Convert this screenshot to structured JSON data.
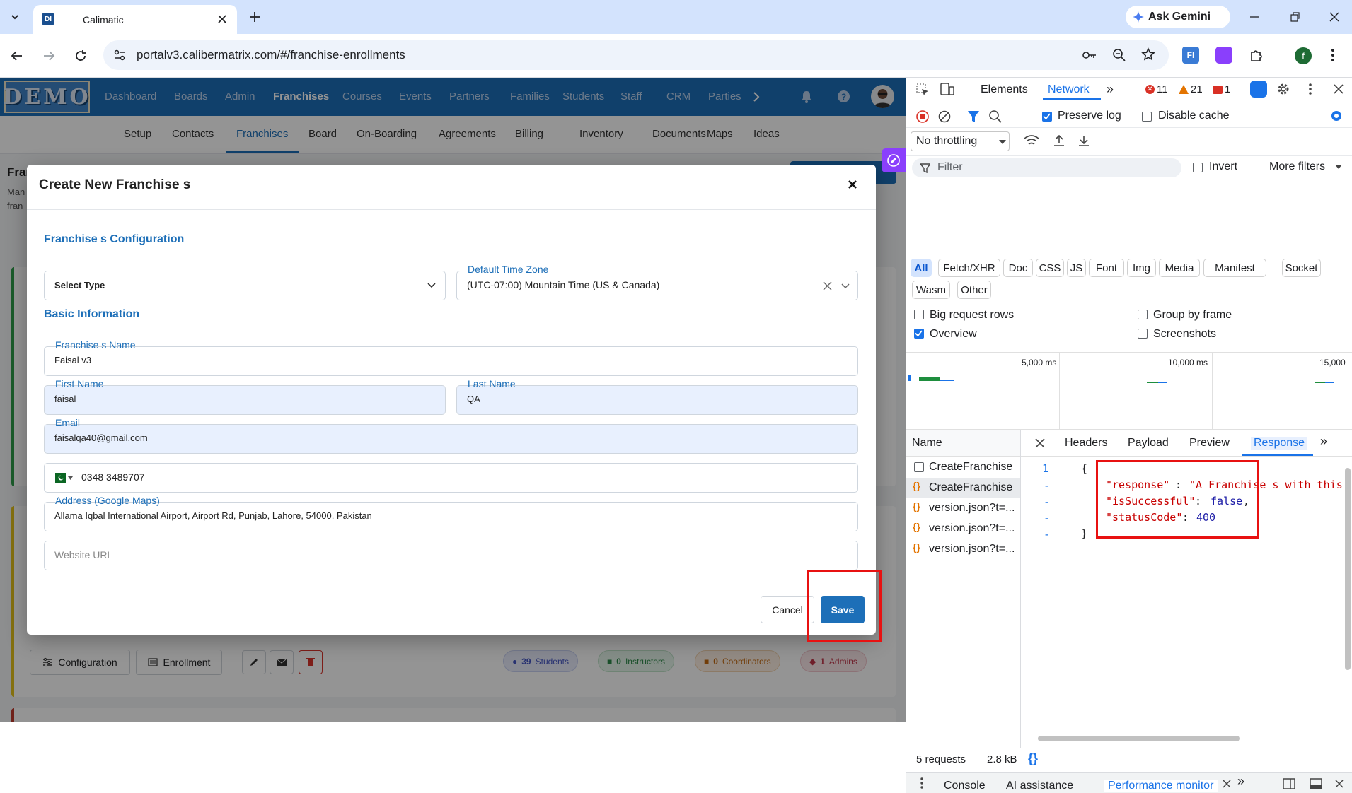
{
  "browser": {
    "tab_title": "Calimatic",
    "url": "portalv3.calibermatrix.com/#/franchise-enrollments",
    "ask_gemini": "Ask Gemini",
    "profile_initial": "f"
  },
  "app": {
    "logo": "DEMO",
    "nav": [
      "Dashboard",
      "Boards",
      "Admin",
      "Franchises",
      "Courses",
      "Events",
      "Partners",
      "Families",
      "Students",
      "Staff",
      "CRM",
      "Parties"
    ],
    "nav_active": "Franchises",
    "subnav": [
      "Setup",
      "Contacts",
      "Franchises",
      "Board",
      "On-Boarding",
      "Agreements",
      "Billing",
      "Inventory",
      "Documents",
      "Maps",
      "Ideas"
    ],
    "subnav_active": "Franchises",
    "bg_title_fragment": "Fran",
    "bg_desc_1": "Man",
    "bg_desc_2": "fran",
    "bottom_toolbar": {
      "configuration": "Configuration",
      "enrollment": "Enrollment",
      "students_count": "39",
      "students_label": "Students",
      "instructors_count": "0",
      "instructors_label": "Instructors",
      "coordinators_count": "0",
      "coordinators_label": "Coordinators",
      "admins_count": "1",
      "admins_label": "Admins"
    }
  },
  "modal": {
    "title": "Create New Franchise s",
    "section_config": "Franchise s Configuration",
    "select_type": "Select Type",
    "timezone_label": "Default Time Zone",
    "timezone_value": "(UTC-07:00) Mountain Time (US & Canada)",
    "section_basic": "Basic Information",
    "franchise_name_label": "Franchise s Name",
    "franchise_name_value": "Faisal v3",
    "first_name_label": "First Name",
    "first_name_value": "faisal",
    "last_name_label": "Last Name",
    "last_name_value": "QA",
    "email_label": "Email",
    "email_value": "faisalqa40@gmail.com",
    "phone_value": "0348 3489707",
    "address_label": "Address (Google Maps)",
    "address_value": "Allama Iqbal International Airport, Airport Rd, Punjab, Lahore, 54000, Pakistan",
    "website_placeholder": "Website URL",
    "cancel": "Cancel",
    "save": "Save"
  },
  "devtools": {
    "tabs": [
      "Elements",
      "Network"
    ],
    "active_tab": "Network",
    "errors": "11",
    "warnings": "21",
    "issues": "1",
    "preserve_log": "Preserve log",
    "disable_cache": "Disable cache",
    "throttling": "No throttling",
    "filter_placeholder": "Filter",
    "invert": "Invert",
    "more_filters": "More filters",
    "filter_chips": [
      "All",
      "Fetch/XHR",
      "Doc",
      "CSS",
      "JS",
      "Font",
      "Img",
      "Media",
      "Manifest",
      "Socket",
      "Wasm",
      "Other"
    ],
    "big_request_rows": "Big request rows",
    "group_by_frame": "Group by frame",
    "overview": "Overview",
    "screenshots": "Screenshots",
    "timeline_ticks": [
      "5,000 ms",
      "10,000 ms",
      "15,000"
    ],
    "name_header": "Name",
    "detail_tabs": [
      "Headers",
      "Payload",
      "Preview",
      "Response"
    ],
    "detail_active": "Response",
    "requests": [
      "CreateFranchise",
      "CreateFranchise",
      "version.json?t=...",
      "version.json?t=...",
      "version.json?t=..."
    ],
    "response": {
      "line1_num": "1",
      "open_brace": "{",
      "k1": "\"response\"",
      "v1": "\"A Franchise s with this",
      "k2": "\"isSuccessful\"",
      "v2": "false",
      "k3": "\"statusCode\"",
      "v3": "400",
      "close_brace": "}",
      "dash": "-"
    },
    "status_requests": "5 requests",
    "status_size": "2.8 kB",
    "drawer_tabs": [
      "Console",
      "AI assistance",
      "Performance monitor"
    ],
    "drawer_active": "Performance monitor"
  },
  "colors": {
    "nav_blue": "#1d6fb8",
    "highlight_red": "#e81111",
    "devtools_blue": "#1a73e8"
  }
}
